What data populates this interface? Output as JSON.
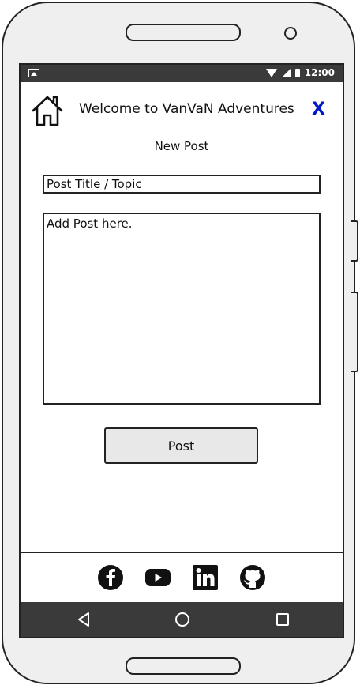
{
  "status_bar": {
    "time": "12:00",
    "icons": [
      "image-icon",
      "wifi-icon",
      "signal-icon",
      "battery-icon"
    ]
  },
  "header": {
    "title": "Welcome to VanVaN Adventures",
    "close_label": "X",
    "close_color": "#0018c8"
  },
  "page": {
    "subtitle": "New Post"
  },
  "form": {
    "title_placeholder": "Post Title / Topic",
    "body_placeholder": "Add Post here.",
    "submit_label": "Post"
  },
  "footer": {
    "social": [
      "facebook-icon",
      "youtube-icon",
      "linkedin-icon",
      "github-icon"
    ]
  },
  "navbar": {
    "buttons": [
      "back-icon",
      "home-circle-icon",
      "recent-apps-icon"
    ]
  }
}
